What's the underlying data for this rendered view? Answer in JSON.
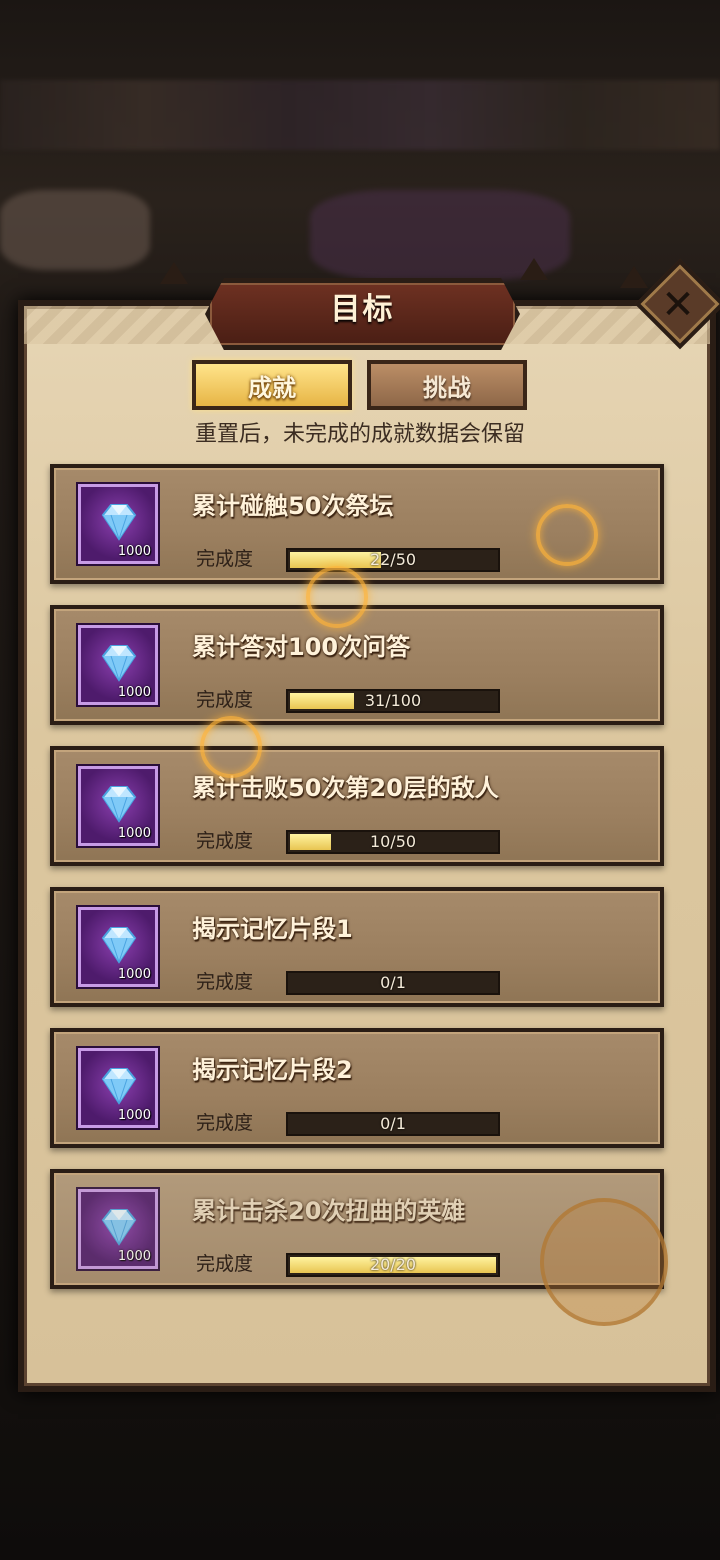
{
  "dialog": {
    "title": "目标",
    "close_symbol": "✕"
  },
  "tabs": [
    {
      "label": "成就",
      "active": true
    },
    {
      "label": "挑战",
      "active": false
    }
  ],
  "hint": "重置后，未完成的成就数据会保留",
  "progress_label": "完成度",
  "achievements": [
    {
      "name": "累计碰触50次祭坛",
      "reward_icon": "diamond-icon",
      "reward_count": "1000",
      "progress_text": "22/50",
      "progress": 0.44,
      "completed": false
    },
    {
      "name": "累计答对100次问答",
      "reward_icon": "diamond-icon",
      "reward_count": "1000",
      "progress_text": "31/100",
      "progress": 0.31,
      "completed": false
    },
    {
      "name": "累计击败50次第20层的敌人",
      "reward_icon": "diamond-icon",
      "reward_count": "1000",
      "progress_text": "10/50",
      "progress": 0.2,
      "completed": false
    },
    {
      "name": "揭示记忆片段1",
      "reward_icon": "diamond-icon",
      "reward_count": "1000",
      "progress_text": "0/1",
      "progress": 0,
      "completed": false
    },
    {
      "name": "揭示记忆片段2",
      "reward_icon": "diamond-icon",
      "reward_count": "1000",
      "progress_text": "0/1",
      "progress": 0,
      "completed": false
    },
    {
      "name": "累计击杀20次扭曲的英雄",
      "reward_icon": "diamond-icon",
      "reward_count": "1000",
      "progress_text": "20/20",
      "progress": 1,
      "completed": true
    }
  ],
  "colors": {
    "panel": "#dcc79f",
    "active_tab": "#e7b545",
    "gem_frame": "#8a3fae",
    "progress_fill": "#e8c552"
  }
}
